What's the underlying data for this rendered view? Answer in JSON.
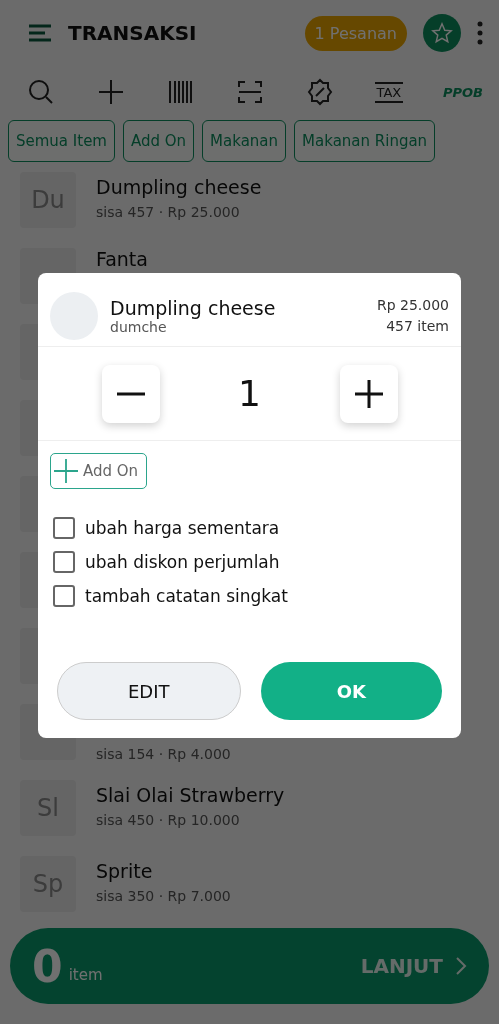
{
  "app_bar": {
    "title": "TRANSAKSI",
    "order_badge": "1 Pesanan"
  },
  "toolbar": [
    {
      "kind": "search"
    },
    {
      "kind": "add"
    },
    {
      "kind": "barcode"
    },
    {
      "kind": "scan"
    },
    {
      "kind": "discount"
    },
    {
      "kind": "tax",
      "label": "TAX"
    },
    {
      "kind": "ppob",
      "label": "PPOB"
    }
  ],
  "categories": [
    {
      "label": "Semua Item"
    },
    {
      "label": "Add On"
    },
    {
      "label": "Makanan"
    },
    {
      "label": "Makanan Ringan"
    }
  ],
  "products": [
    {
      "kind": "item",
      "avatar": "Du",
      "name": "Dumpling cheese",
      "detail": "sisa 457 · Rp 25.000"
    },
    {
      "kind": "item",
      "name": "Fanta"
    },
    {
      "kind": "item"
    },
    {
      "kind": "item"
    },
    {
      "kind": "item"
    },
    {
      "kind": "item"
    },
    {
      "kind": "item"
    },
    {
      "kind": "item",
      "detail": "sisa 154 · Rp 4.000"
    },
    {
      "kind": "item",
      "avatar": "Sl",
      "name": "Slai Olai Strawberry",
      "detail": "sisa 450 · Rp 10.000"
    },
    {
      "kind": "item",
      "avatar": "Sp",
      "name": "Sprite",
      "detail": "sisa 350 · Rp 7.000"
    }
  ],
  "bottom_bar": {
    "count": "0",
    "unit": "item",
    "action": "LANJUT"
  },
  "dialog": {
    "name": "Dumpling cheese",
    "code": "dumche",
    "price": "Rp 25.000",
    "stock": "457 item",
    "quantity": "1",
    "add_on": "Add On",
    "options": [
      {
        "label": "ubah harga sementara",
        "checked": false
      },
      {
        "label": "ubah diskon perjumlah",
        "checked": false
      },
      {
        "label": "tambah catatan singkat",
        "checked": false
      }
    ],
    "buttons": [
      {
        "kind": "secondary",
        "label": "EDIT"
      },
      {
        "kind": "primary",
        "label": "OK"
      }
    ]
  }
}
